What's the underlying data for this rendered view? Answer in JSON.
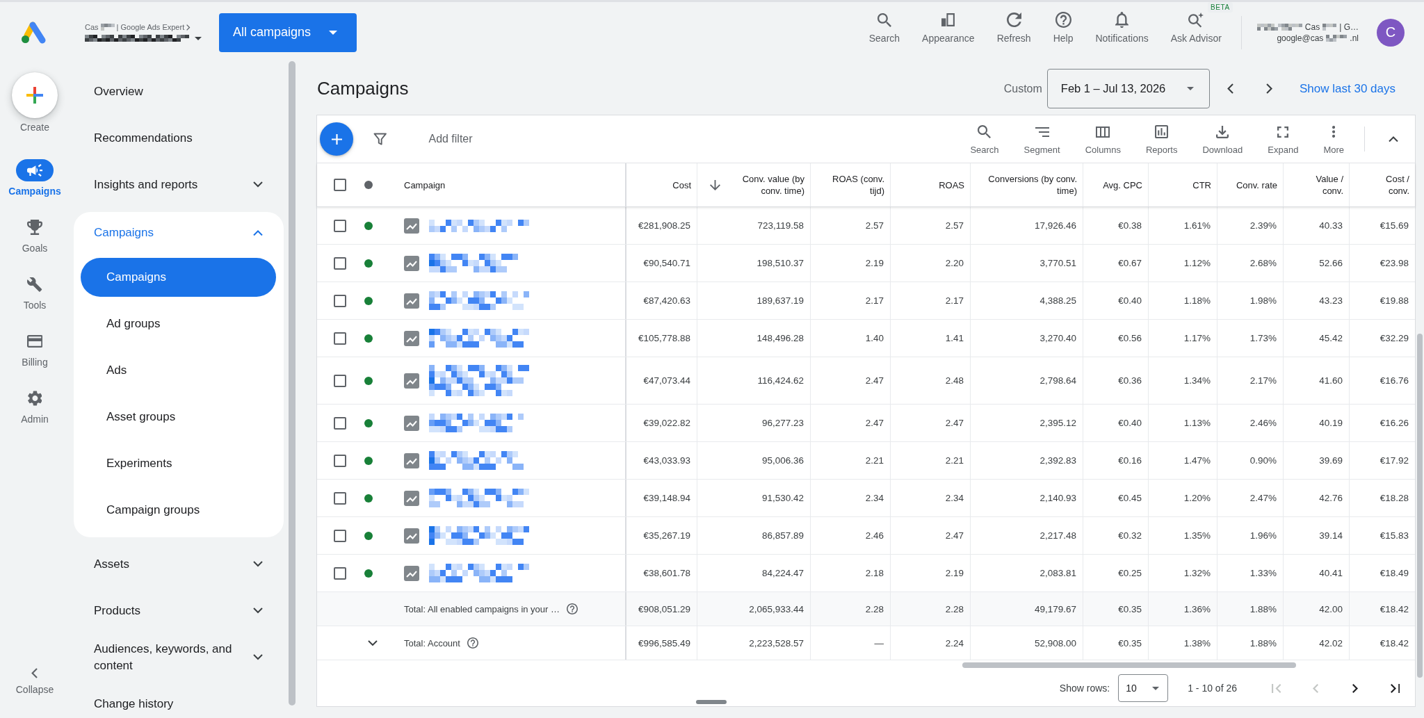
{
  "header": {
    "account_path": [
      "Cas",
      "| Google Ads Expert"
    ],
    "scope_button": "All campaigns",
    "actions": [
      {
        "kind": "search",
        "label": "Search"
      },
      {
        "kind": "appearance",
        "label": "Appearance"
      },
      {
        "kind": "refresh",
        "label": "Refresh"
      },
      {
        "kind": "help",
        "label": "Help"
      },
      {
        "kind": "notifications",
        "label": "Notifications"
      },
      {
        "kind": "advisor",
        "label": "Ask Advisor",
        "badge": "BETA"
      }
    ],
    "user": {
      "name_parts": [
        "Cas",
        "| G…"
      ],
      "email_parts": [
        "google@cas",
        ".nl"
      ],
      "avatar_letter": "C"
    }
  },
  "rail": {
    "create": "Create",
    "items": [
      {
        "kind": "campaigns",
        "label": "Campaigns",
        "selected": true
      },
      {
        "kind": "goals",
        "label": "Goals",
        "selected": false
      },
      {
        "kind": "tools",
        "label": "Tools",
        "selected": false
      },
      {
        "kind": "billing",
        "label": "Billing",
        "selected": false
      },
      {
        "kind": "admin",
        "label": "Admin",
        "selected": false
      }
    ],
    "collapse": "Collapse"
  },
  "nav": {
    "items": [
      {
        "kind": "link",
        "label": "Overview"
      },
      {
        "kind": "link",
        "label": "Recommendations"
      },
      {
        "kind": "group",
        "label": "Insights and reports",
        "expanded": false
      },
      {
        "kind": "group",
        "label": "Campaigns",
        "expanded": true,
        "children": [
          {
            "label": "Campaigns",
            "selected": true
          },
          {
            "label": "Ad groups",
            "selected": false
          },
          {
            "label": "Ads",
            "selected": false
          },
          {
            "label": "Asset groups",
            "selected": false
          },
          {
            "label": "Experiments",
            "selected": false
          },
          {
            "label": "Campaign groups",
            "selected": false
          }
        ]
      },
      {
        "kind": "group",
        "label": "Assets",
        "expanded": false
      },
      {
        "kind": "group",
        "label": "Products",
        "expanded": false
      },
      {
        "kind": "group",
        "label": "Audiences, keywords, and content",
        "expanded": false
      },
      {
        "kind": "link",
        "label": "Change history"
      }
    ]
  },
  "page": {
    "title": "Campaigns",
    "date_preset": "Custom",
    "date_range": "Feb 1 – Jul 13, 2026",
    "quick_range_link": "Show last 30 days"
  },
  "toolbar": {
    "filter": {
      "placeholder": "Add filter"
    },
    "tools": [
      {
        "kind": "search",
        "label": "Search"
      },
      {
        "kind": "segment",
        "label": "Segment"
      },
      {
        "kind": "columns",
        "label": "Columns"
      },
      {
        "kind": "reports",
        "label": "Reports"
      },
      {
        "kind": "download",
        "label": "Download"
      },
      {
        "kind": "expand",
        "label": "Expand"
      },
      {
        "kind": "more",
        "label": "More"
      }
    ]
  },
  "table": {
    "select_all": {
      "checked": false
    },
    "columns": [
      {
        "kind": "name",
        "label": "Campaign",
        "sorted": false
      },
      {
        "kind": "metric",
        "label": "Cost",
        "sorted": false
      },
      {
        "kind": "metric",
        "label": "Conv. value (by conv. time)",
        "sorted": true
      },
      {
        "kind": "metric",
        "label": "ROAS (conv. tijd)",
        "sorted": false
      },
      {
        "kind": "metric",
        "label": "ROAS",
        "sorted": false
      },
      {
        "kind": "metric",
        "label": "Conversions (by conv. time)",
        "sorted": false
      },
      {
        "kind": "metric",
        "label": "Avg. CPC",
        "sorted": false
      },
      {
        "kind": "metric",
        "label": "CTR",
        "sorted": false
      },
      {
        "kind": "metric",
        "label": "Conv. rate",
        "sorted": false
      },
      {
        "kind": "metric",
        "label": "Value / conv.",
        "sorted": false
      },
      {
        "kind": "metric",
        "label": "Cost / conv.",
        "sorted": false
      }
    ],
    "rows": [
      {
        "checked": false,
        "color": "#188038",
        "values": [
          "€281,908.25",
          "723,119.58",
          "2.57",
          "2.57",
          "17,926.46",
          "€0.38",
          "1.61%",
          "2.39%",
          "40.33",
          "€15.69"
        ]
      },
      {
        "checked": false,
        "color": "#188038",
        "values": [
          "€90,540.71",
          "198,510.37",
          "2.19",
          "2.20",
          "3,770.51",
          "€0.67",
          "1.12%",
          "2.68%",
          "52.66",
          "€23.98"
        ]
      },
      {
        "checked": false,
        "color": "#188038",
        "values": [
          "€87,420.63",
          "189,637.19",
          "2.17",
          "2.17",
          "4,388.25",
          "€0.40",
          "1.18%",
          "1.98%",
          "43.23",
          "€19.88"
        ]
      },
      {
        "checked": false,
        "color": "#188038",
        "values": [
          "€105,778.88",
          "148,496.28",
          "1.40",
          "1.41",
          "3,270.40",
          "€0.56",
          "1.17%",
          "1.73%",
          "45.42",
          "€32.29"
        ]
      },
      {
        "checked": false,
        "color": "#188038",
        "values": [
          "€47,073.44",
          "116,424.62",
          "2.47",
          "2.48",
          "2,798.64",
          "€0.36",
          "1.34%",
          "2.17%",
          "41.60",
          "€16.76"
        ]
      },
      {
        "checked": false,
        "color": "#188038",
        "values": [
          "€39,022.82",
          "96,277.23",
          "2.47",
          "2.47",
          "2,395.12",
          "€0.40",
          "1.13%",
          "2.46%",
          "40.19",
          "€16.26"
        ]
      },
      {
        "checked": false,
        "color": "#188038",
        "values": [
          "€43,033.93",
          "95,006.36",
          "2.21",
          "2.21",
          "2,392.83",
          "€0.16",
          "1.47%",
          "0.90%",
          "39.69",
          "€17.92"
        ]
      },
      {
        "checked": false,
        "color": "#188038",
        "values": [
          "€39,148.94",
          "91,530.42",
          "2.34",
          "2.34",
          "2,140.93",
          "€0.45",
          "1.20%",
          "2.47%",
          "42.76",
          "€18.28"
        ]
      },
      {
        "checked": false,
        "color": "#188038",
        "values": [
          "€35,267.19",
          "86,857.89",
          "2.46",
          "2.47",
          "2,217.48",
          "€0.32",
          "1.35%",
          "1.96%",
          "39.14",
          "€15.83"
        ]
      },
      {
        "checked": false,
        "color": "#188038",
        "values": [
          "€38,601.78",
          "84,224.47",
          "2.18",
          "2.19",
          "2,083.81",
          "€0.25",
          "1.32%",
          "1.33%",
          "40.41",
          "€18.49"
        ]
      }
    ],
    "totals": [
      {
        "kind": "filtered",
        "label": "Total: All enabled campaigns in your …",
        "values": [
          "€908,051.29",
          "2,065,933.44",
          "2.28",
          "2.28",
          "49,179.67",
          "€0.35",
          "1.36%",
          "1.88%",
          "42.00",
          "€18.42"
        ]
      },
      {
        "kind": "account",
        "label": "Total: Account",
        "expanded": false,
        "values": [
          "€996,585.49",
          "2,223,528.57",
          "—",
          "2.24",
          "52,908.00",
          "€0.35",
          "1.38%",
          "1.88%",
          "42.02",
          "€18.42"
        ]
      }
    ]
  },
  "pagination": {
    "label": "Show rows:",
    "page_size": "10",
    "range": "1 - 10 of 26",
    "buttons": [
      {
        "kind": "first",
        "disabled": true
      },
      {
        "kind": "previous",
        "disabled": true
      },
      {
        "kind": "next",
        "disabled": false
      },
      {
        "kind": "last",
        "disabled": false
      }
    ]
  }
}
